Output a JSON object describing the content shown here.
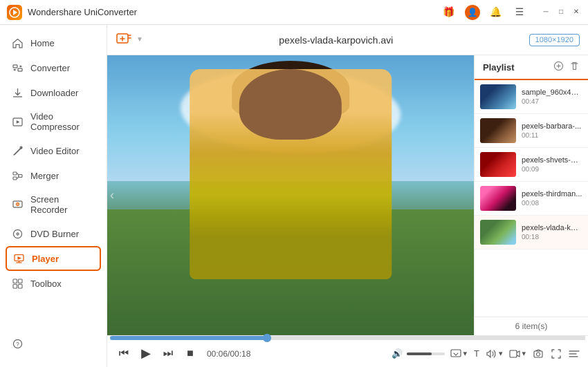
{
  "app": {
    "title": "Wondershare UniConverter",
    "logo_text": "W"
  },
  "titlebar": {
    "icons": [
      "gift-icon",
      "user-icon",
      "bell-icon",
      "menu-icon"
    ],
    "window_controls": [
      "minimize",
      "maximize",
      "close"
    ]
  },
  "sidebar": {
    "items": [
      {
        "id": "home",
        "label": "Home",
        "icon": "🏠"
      },
      {
        "id": "converter",
        "label": "Converter",
        "icon": "↔"
      },
      {
        "id": "downloader",
        "label": "Downloader",
        "icon": "↓"
      },
      {
        "id": "video-compressor",
        "label": "Video Compressor",
        "icon": "⊞"
      },
      {
        "id": "video-editor",
        "label": "Video Editor",
        "icon": "✦"
      },
      {
        "id": "merger",
        "label": "Merger",
        "icon": "⊟"
      },
      {
        "id": "screen-recorder",
        "label": "Screen Recorder",
        "icon": "▣"
      },
      {
        "id": "dvd-burner",
        "label": "DVD Burner",
        "icon": "⊙"
      },
      {
        "id": "player",
        "label": "Player",
        "icon": "▶",
        "active": true
      },
      {
        "id": "toolbox",
        "label": "Toolbox",
        "icon": "⊞"
      }
    ],
    "bottom_items": [
      {
        "id": "help",
        "icon": "?"
      },
      {
        "id": "notifications",
        "icon": "🔔"
      },
      {
        "id": "feedback",
        "icon": "☺"
      }
    ]
  },
  "topbar": {
    "file_title": "pexels-vlada-karpovich.avi",
    "resolution": "1080×1920",
    "add_label": "+"
  },
  "playlist": {
    "title": "Playlist",
    "items": [
      {
        "name": "sample_960x400...",
        "duration": "00:47",
        "thumb_class": "thumb-1"
      },
      {
        "name": "pexels-barbara-...",
        "duration": "00:11",
        "thumb_class": "thumb-2"
      },
      {
        "name": "pexels-shvets-pr...",
        "duration": "00:09",
        "thumb_class": "thumb-3"
      },
      {
        "name": "pexels-thirdman...",
        "duration": "00:08",
        "thumb_class": "thumb-4"
      },
      {
        "name": "pexels-vlada-kar...",
        "duration": "00:18",
        "thumb_class": "thumb-5",
        "active": true
      }
    ],
    "count_label": "6 item(s)"
  },
  "controls": {
    "current_time": "00:06",
    "total_time": "00:18",
    "time_display": "00:06/00:18",
    "progress_percent": 33
  }
}
